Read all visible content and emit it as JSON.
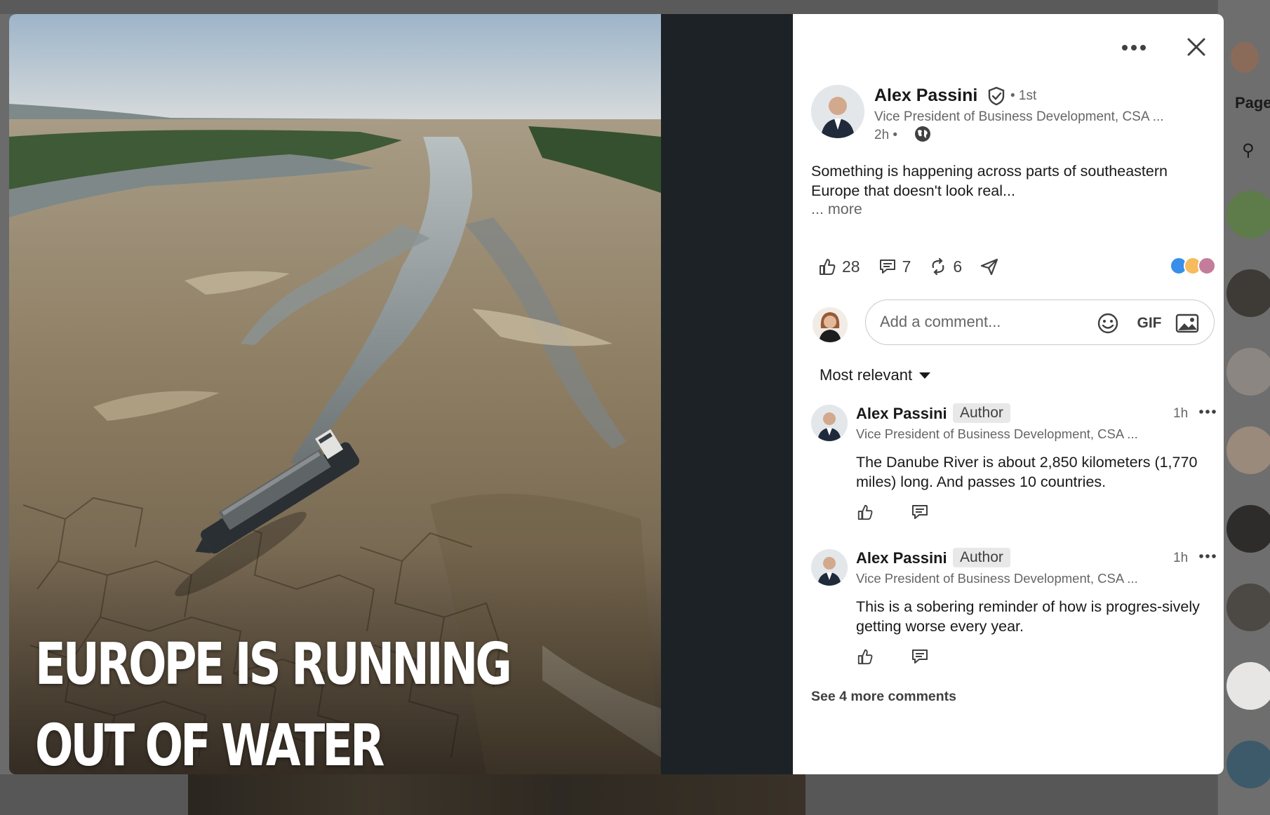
{
  "photo": {
    "headline_line1": "EUROPE IS RUNNING",
    "headline_line2": "OUT OF WATER"
  },
  "post": {
    "author_name": "Alex Passini",
    "degree": "• 1st",
    "author_headline": "Vice President of Business Development, CSA ...",
    "time": "2h •",
    "text": "Something is happening across parts of southeastern Europe that doesn't look real...",
    "see_more": "... more",
    "reactions_count": "28",
    "comments_count": "7",
    "reposts_count": "6"
  },
  "composer": {
    "placeholder": "Add a comment...",
    "gif_label": "GIF"
  },
  "sort": {
    "label": "Most relevant"
  },
  "comments": [
    {
      "name": "Alex Passini",
      "badge": "Author",
      "time": "1h",
      "headline": "Vice President of Business Development, CSA ...",
      "text": "The Danube River is about 2,850 kilometers (1,770 miles) long. And passes 10 countries."
    },
    {
      "name": "Alex Passini",
      "badge": "Author",
      "time": "1h",
      "headline": "Vice President of Business Development, CSA ...",
      "text": "This is a sobering reminder of how is progres-sively  getting worse every year."
    }
  ],
  "see_more_comments": "See 4 more comments",
  "background": {
    "pages_label": "Page"
  },
  "colors": {
    "panel_bg": "#ffffff",
    "media_bg": "#1d2226",
    "secondary_text": "#666666",
    "primary_text": "#191919"
  }
}
